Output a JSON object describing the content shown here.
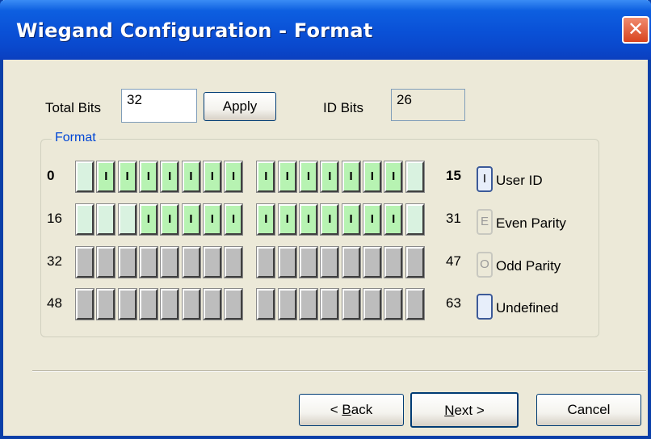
{
  "window": {
    "title": "Wiegand Configuration - Format",
    "close_glyph": "✕"
  },
  "total_bits": {
    "label": "Total Bits",
    "value": "32"
  },
  "apply_button": {
    "label": "Apply"
  },
  "id_bits": {
    "label": "ID Bits",
    "value": "26"
  },
  "format_group": {
    "legend": "Format",
    "rows": [
      {
        "start": "0",
        "end": "15",
        "bits": [
          "U",
          "I",
          "I",
          "I",
          "I",
          "I",
          "I",
          "I",
          "I",
          "I",
          "I",
          "I",
          "I",
          "I",
          "I",
          "U"
        ]
      },
      {
        "start": "16",
        "end": "31",
        "bits": [
          "U",
          "U",
          "U",
          "I",
          "I",
          "I",
          "I",
          "I",
          "I",
          "I",
          "I",
          "I",
          "I",
          "I",
          "I",
          "U"
        ]
      },
      {
        "start": "32",
        "end": "47",
        "bits": [
          "G",
          "G",
          "G",
          "G",
          "G",
          "G",
          "G",
          "G",
          "G",
          "G",
          "G",
          "G",
          "G",
          "G",
          "G",
          "G"
        ]
      },
      {
        "start": "48",
        "end": "63",
        "bits": [
          "G",
          "G",
          "G",
          "G",
          "G",
          "G",
          "G",
          "G",
          "G",
          "G",
          "G",
          "G",
          "G",
          "G",
          "G",
          "G"
        ]
      }
    ],
    "bit_letters": {
      "I": "I",
      "U": "",
      "G": ""
    }
  },
  "legend": {
    "user_id": {
      "glyph": "I",
      "label": "User ID"
    },
    "even_parity": {
      "glyph": "E",
      "label": "Even Parity"
    },
    "odd_parity": {
      "glyph": "O",
      "label": "Odd Parity"
    },
    "undefined": {
      "glyph": "",
      "label": "Undefined"
    }
  },
  "footer": {
    "back": {
      "prefix": "< ",
      "mnemonic": "B",
      "rest": "ack"
    },
    "next": {
      "mnemonic": "N",
      "rest": "ext >"
    },
    "cancel": "Cancel"
  },
  "colors": {
    "titlebar": "#0a50d6",
    "dialog_bg": "#ece9d8",
    "id_bit": "#b7f3b2",
    "unused_bit": "#d9f2e0",
    "disabled_bit": "#bdbdbd",
    "group_legend": "#0046d5"
  }
}
